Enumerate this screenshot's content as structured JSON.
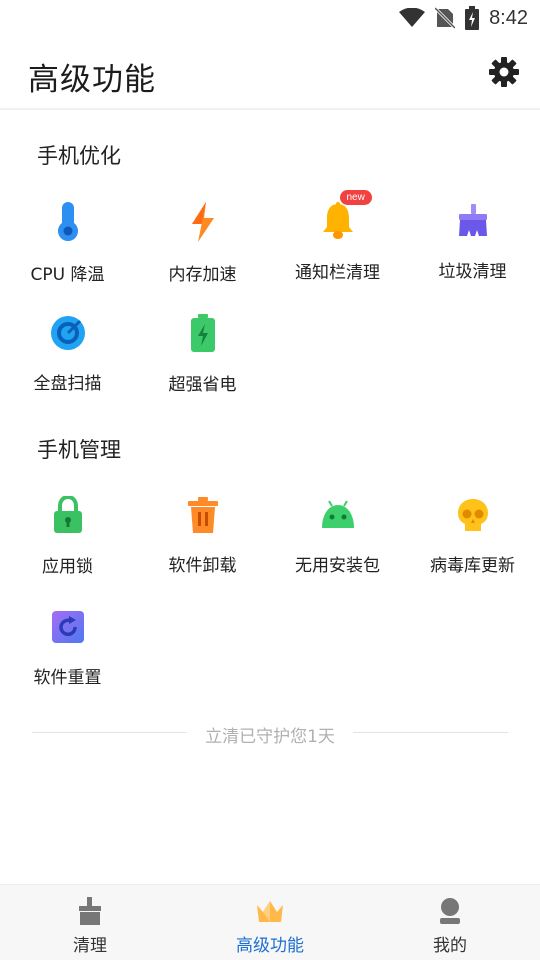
{
  "status_bar": {
    "time": "8:42"
  },
  "header": {
    "title": "高级功能"
  },
  "sections": [
    {
      "title": "手机优化",
      "items": [
        {
          "label": "CPU 降温",
          "icon": "thermometer-icon"
        },
        {
          "label": "内存加速",
          "icon": "lightning-icon"
        },
        {
          "label": "通知栏清理",
          "icon": "bell-icon",
          "badge": "new"
        },
        {
          "label": "垃圾清理",
          "icon": "broom-icon"
        },
        {
          "label": "全盘扫描",
          "icon": "scan-icon"
        },
        {
          "label": "超强省电",
          "icon": "battery-icon"
        }
      ]
    },
    {
      "title": "手机管理",
      "items": [
        {
          "label": "应用锁",
          "icon": "lock-icon"
        },
        {
          "label": "软件卸载",
          "icon": "trash-icon"
        },
        {
          "label": "无用安装包",
          "icon": "android-icon"
        },
        {
          "label": "病毒库更新",
          "icon": "skull-icon"
        },
        {
          "label": "软件重置",
          "icon": "reset-icon"
        }
      ]
    }
  ],
  "footer_note": "立清已守护您1天",
  "bottom_nav": [
    {
      "label": "清理",
      "icon": "broom-nav-icon",
      "active": false
    },
    {
      "label": "高级功能",
      "icon": "crown-icon",
      "active": true
    },
    {
      "label": "我的",
      "icon": "user-icon",
      "active": false
    }
  ],
  "colors": {
    "accent": "#1f6fd1",
    "badge": "#f24141",
    "thermometer": "#2d8ff0",
    "lightning": "#ff8a1f",
    "bell": "#ffb300",
    "broom": "#7c6cf0",
    "scan": "#1fa3f2",
    "battery": "#3cc96a",
    "lock": "#39c162",
    "trash": "#ff8a28",
    "android": "#3ccf6b",
    "skull": "#ffc21a",
    "reset": "#6a6af0"
  }
}
